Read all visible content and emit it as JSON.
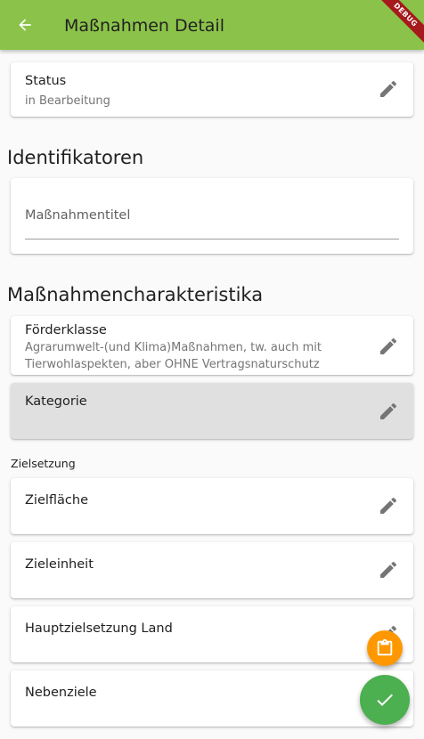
{
  "appbar": {
    "title": "Maßnahmen Detail",
    "back_icon": "arrow-back-icon",
    "color": "#8bc34a",
    "debug_banner": "DEBUG"
  },
  "status_card": {
    "label": "Status",
    "value": "in Bearbeitung"
  },
  "identifikatoren": {
    "title": "Identifikatoren",
    "field_label": "Maßnahmentitel",
    "field_value": ""
  },
  "charakteristika": {
    "title": "Maßnahmencharakteristika",
    "foerderklasse": {
      "label": "Förderklasse",
      "value_line1": "Agrarumwelt-(und Klima)Maßnahmen, tw. auch mit",
      "value_line2": "Tierwohlaspekten, aber OHNE Vertragsnaturschutz"
    },
    "kategorie": {
      "label": "Kategorie"
    }
  },
  "zielsetzung": {
    "title": "Zielsetzung",
    "items": [
      {
        "label": "Zielfläche"
      },
      {
        "label": "Zieleinheit"
      },
      {
        "label": "Hauptzielsetzung Land"
      },
      {
        "label": "Nebenziele"
      }
    ]
  },
  "icons": {
    "edit": "pencil-icon",
    "clipboard": "clipboard-icon",
    "check": "check-icon"
  },
  "colors": {
    "fab_orange": "#ff9800",
    "fab_green": "#4caf50",
    "highlight_card": "#e0e0e0"
  }
}
